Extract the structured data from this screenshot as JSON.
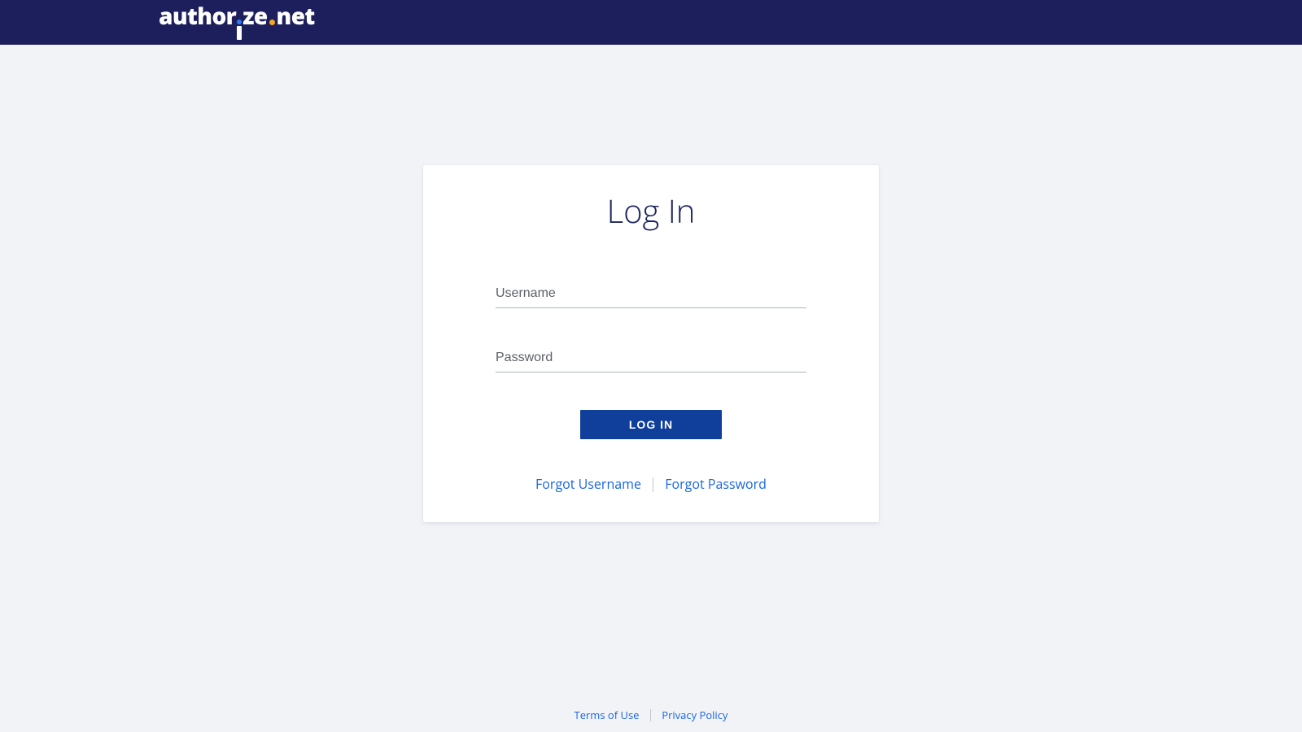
{
  "header": {
    "brand_prefix": "author",
    "brand_suffix": "ze",
    "brand_tld": "net"
  },
  "card": {
    "title": "Log In",
    "fields": {
      "username_placeholder": "Username",
      "password_placeholder": "Password"
    },
    "submit_label": "LOG IN",
    "links": {
      "forgot_username": "Forgot Username",
      "forgot_password": "Forgot Password"
    }
  },
  "footer": {
    "terms": "Terms of Use",
    "privacy": "Privacy Policy"
  }
}
